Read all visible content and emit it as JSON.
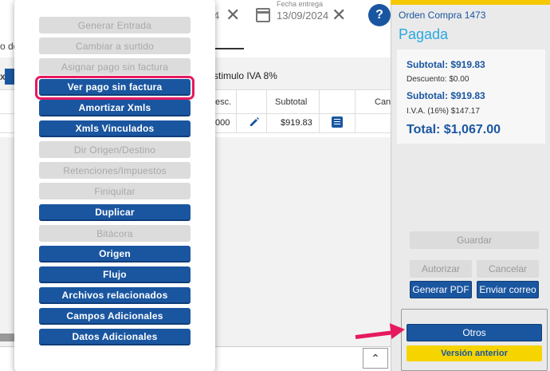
{
  "header": {
    "date_fragment": "4",
    "fecha_entrega_label": "Fecha entrega",
    "fecha_entrega_value": "13/09/2024",
    "help_label": "?",
    "left_fragment": "o de",
    "left_fragment2": "x"
  },
  "content": {
    "estimulo_text": "stimulo IVA 8%",
    "table": {
      "headers": [
        "esc.",
        "Subtotal",
        "Can"
      ],
      "row": {
        "desc_value": "000",
        "subtotal": "$919.83"
      }
    },
    "collapse_button": "⌃"
  },
  "menu": {
    "items": [
      {
        "label": "Generar Entrada",
        "enabled": false
      },
      {
        "label": "Cambiar a surtido",
        "enabled": false
      },
      {
        "label": "Asignar pago sin factura",
        "enabled": false
      },
      {
        "label": "Ver pago sin factura",
        "enabled": true,
        "highlighted": true
      },
      {
        "label": "Amortizar Xmls",
        "enabled": true
      },
      {
        "label": "Xmls Vinculados",
        "enabled": true
      },
      {
        "label": "Dir Origen/Destino",
        "enabled": false
      },
      {
        "label": "Retenciones/Impuestos",
        "enabled": false
      },
      {
        "label": "Finiquitar",
        "enabled": false
      },
      {
        "label": "Duplicar",
        "enabled": true
      },
      {
        "label": "Bitácora",
        "enabled": false
      },
      {
        "label": "Origen",
        "enabled": true
      },
      {
        "label": "Flujo",
        "enabled": true
      },
      {
        "label": "Archivos relacionados",
        "enabled": true
      },
      {
        "label": "Campos Adicionales",
        "enabled": true
      },
      {
        "label": "Datos Adicionales",
        "enabled": true
      }
    ]
  },
  "order_panel": {
    "title": "Orden Compra 1473",
    "status": "Pagada",
    "subtotal1": "Subtotal: $919.83",
    "descuento": "Descuento: $0.00",
    "subtotal2": "Subtotal: $919.83",
    "iva": "I.V.A. (16%) $147.17",
    "total": "Total: $1,067.00",
    "buttons": {
      "guardar": "Guardar",
      "autorizar": "Autorizar",
      "cancelar": "Cancelar",
      "generar_pdf": "Generar PDF",
      "enviar_correo": "Enviar correo",
      "otros": "Otros",
      "version_anterior": "Versión anterior"
    }
  },
  "colors": {
    "primary": "#1a56a0",
    "status": "#29a8e0",
    "accent_yellow": "#f5d400",
    "highlight": "#e6195f",
    "disabled_bg": "#dcdcdc"
  }
}
